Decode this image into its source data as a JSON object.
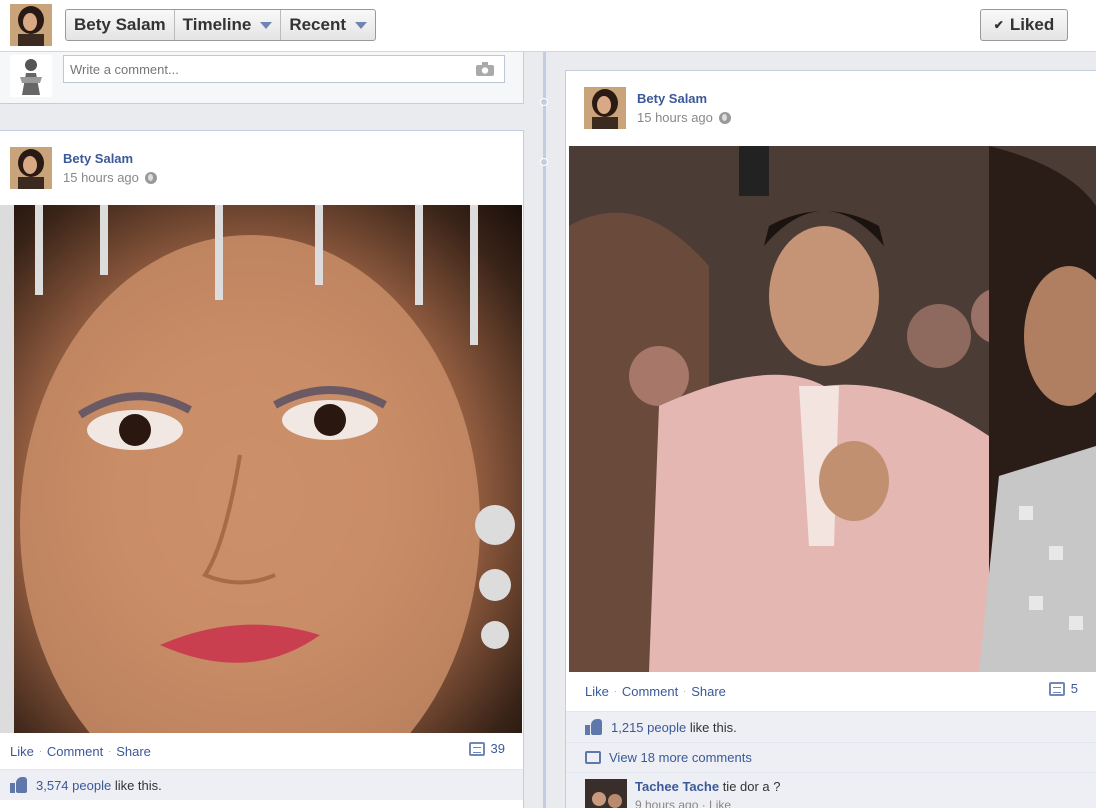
{
  "header": {
    "profile_name": "Bety Salam",
    "nav_timeline": "Timeline",
    "nav_recent": "Recent",
    "liked_label": "Liked",
    "liked_check": "✔"
  },
  "composer": {
    "placeholder": "Write a comment..."
  },
  "posts": [
    {
      "author": "Bety Salam",
      "time": "15 hours ago",
      "actions": [
        "Like",
        "Comment",
        "Share"
      ],
      "comment_count": "39",
      "likes_count": "3,574 people",
      "likes_suffix": "like this."
    },
    {
      "author": "Bety Salam",
      "time": "15 hours ago",
      "actions": [
        "Like",
        "Comment",
        "Share"
      ],
      "comment_count": "5",
      "likes_count": "1,215 people",
      "likes_suffix": "like this.",
      "view_more": "View 18 more comments",
      "comment": {
        "name": "Tachee Tache",
        "text": "tie dor a ?",
        "meta": "9 hours ago · Like"
      }
    }
  ],
  "colors": {
    "link": "#3b5998",
    "spine": "#c4cde0",
    "ufi_bg": "#edeff4"
  }
}
